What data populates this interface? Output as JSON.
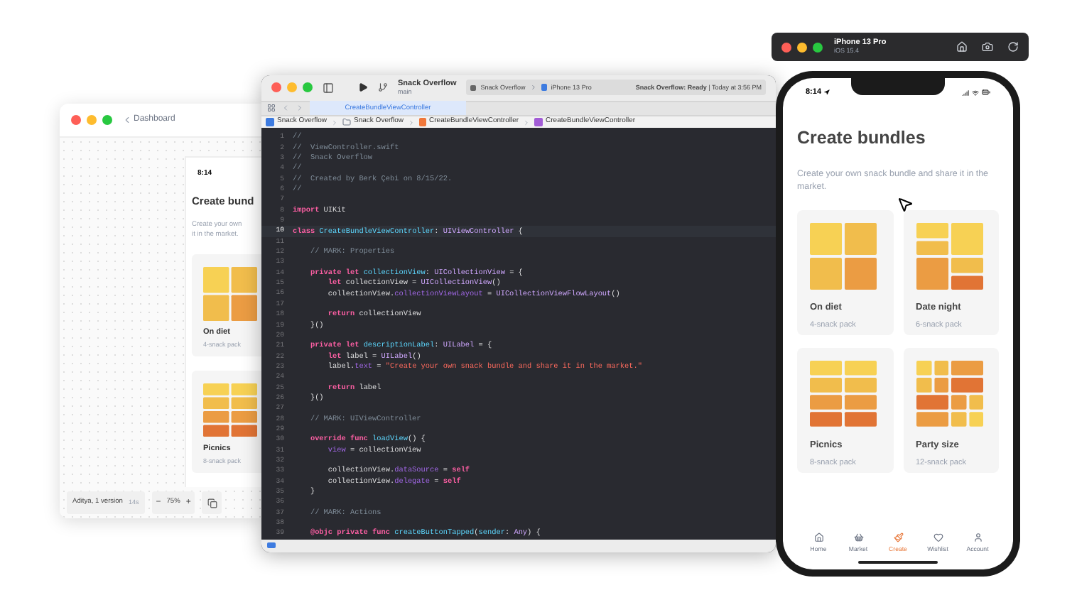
{
  "figma_window": {
    "back_label": "Dashboard",
    "time": "8:14",
    "title": "Create bund",
    "description_lines": [
      "Create your own",
      "it in the market."
    ],
    "cards": [
      {
        "kind": "quad",
        "name": "On diet",
        "pack": "4-snack pack"
      },
      {
        "kind": "stripes",
        "name": "Picnics",
        "pack": "8-snack pack"
      }
    ],
    "author": "Aditya, 1 version",
    "elapsed": "14s",
    "zoom_minus": "−",
    "zoom": "75%",
    "zoom_plus": "+"
  },
  "xcode": {
    "project": "Snack Overflow",
    "branch": "main",
    "scheme": "Snack Overflow",
    "device": "iPhone 13 Pro",
    "status_bold": "Snack Overflow: Ready",
    "status_rest": " | Today at 3:56 PM",
    "tab": "CreateBundleViewController",
    "breadcrumbs": [
      {
        "kind": "project",
        "label": "Snack Overflow"
      },
      {
        "kind": "folder",
        "label": "Snack Overflow"
      },
      {
        "kind": "swift",
        "label": "CreateBundleViewController"
      },
      {
        "kind": "class",
        "label": "CreateBundleViewController"
      }
    ],
    "lines": [
      {
        "number": "1",
        "current": false,
        "tokens": [
          {
            "kind": "c",
            "text": "//"
          }
        ]
      },
      {
        "number": "2",
        "current": false,
        "tokens": [
          {
            "kind": "c",
            "text": "//  ViewController.swift"
          }
        ]
      },
      {
        "number": "3",
        "current": false,
        "tokens": [
          {
            "kind": "c",
            "text": "//  Snack Overflow"
          }
        ]
      },
      {
        "number": "4",
        "current": false,
        "tokens": [
          {
            "kind": "c",
            "text": "//"
          }
        ]
      },
      {
        "number": "5",
        "current": false,
        "tokens": [
          {
            "kind": "c",
            "text": "//  Created by Berk Çebi on 8/15/22."
          }
        ]
      },
      {
        "number": "6",
        "current": false,
        "tokens": [
          {
            "kind": "c",
            "text": "//"
          }
        ]
      },
      {
        "number": "7",
        "current": false
      },
      {
        "number": "8",
        "current": false,
        "tokens": [
          {
            "kind": "k",
            "text": "import"
          },
          {
            "kind": "p",
            "text": " UIKit"
          }
        ]
      },
      {
        "number": "9",
        "current": false
      },
      {
        "number": "10",
        "current": true,
        "tokens": [
          {
            "kind": "k",
            "text": "class"
          },
          {
            "kind": "d",
            "text": " CreateBundleViewController"
          },
          {
            "kind": "p",
            "text": ": "
          },
          {
            "kind": "t",
            "text": "UIViewController"
          },
          {
            "kind": "p",
            "text": " {"
          }
        ]
      },
      {
        "number": "11",
        "current": false
      },
      {
        "number": "12",
        "current": false,
        "tokens": [
          {
            "kind": "c",
            "text": "    // MARK: Properties"
          }
        ]
      },
      {
        "number": "13",
        "current": false
      },
      {
        "number": "14",
        "current": false,
        "tokens": [
          {
            "kind": "k",
            "text": "    private let"
          },
          {
            "kind": "d",
            "text": " collectionView"
          },
          {
            "kind": "p",
            "text": ": "
          },
          {
            "kind": "t",
            "text": "UICollectionView"
          },
          {
            "kind": "p",
            "text": " = {"
          }
        ]
      },
      {
        "number": "15",
        "current": false,
        "tokens": [
          {
            "kind": "k",
            "text": "        let"
          },
          {
            "kind": "p",
            "text": " collectionView = "
          },
          {
            "kind": "t",
            "text": "UICollectionView"
          },
          {
            "kind": "p",
            "text": "()"
          }
        ]
      },
      {
        "number": "16",
        "current": false,
        "tokens": [
          {
            "kind": "p",
            "text": "        collectionView."
          },
          {
            "kind": "m",
            "text": "collectionViewLayout"
          },
          {
            "kind": "p",
            "text": " = "
          },
          {
            "kind": "t",
            "text": "UICollectionViewFlowLayout"
          },
          {
            "kind": "p",
            "text": "()"
          }
        ]
      },
      {
        "number": "17",
        "current": false
      },
      {
        "number": "18",
        "current": false,
        "tokens": [
          {
            "kind": "k",
            "text": "        return"
          },
          {
            "kind": "p",
            "text": " collectionView"
          }
        ]
      },
      {
        "number": "19",
        "current": false,
        "tokens": [
          {
            "kind": "p",
            "text": "    }()"
          }
        ]
      },
      {
        "number": "20",
        "current": false
      },
      {
        "number": "21",
        "current": false,
        "tokens": [
          {
            "kind": "k",
            "text": "    private let"
          },
          {
            "kind": "d",
            "text": " descriptionLabel"
          },
          {
            "kind": "p",
            "text": ": "
          },
          {
            "kind": "t",
            "text": "UILabel"
          },
          {
            "kind": "p",
            "text": " = {"
          }
        ]
      },
      {
        "number": "22",
        "current": false,
        "tokens": [
          {
            "kind": "k",
            "text": "        let"
          },
          {
            "kind": "p",
            "text": " label = "
          },
          {
            "kind": "t",
            "text": "UILabel"
          },
          {
            "kind": "p",
            "text": "()"
          }
        ]
      },
      {
        "number": "23",
        "current": false,
        "tokens": [
          {
            "kind": "p",
            "text": "        label."
          },
          {
            "kind": "m",
            "text": "text"
          },
          {
            "kind": "p",
            "text": " = "
          },
          {
            "kind": "s",
            "text": "\"Create your own snack bundle and share it in the market.\""
          }
        ]
      },
      {
        "number": "24",
        "current": false
      },
      {
        "number": "25",
        "current": false,
        "tokens": [
          {
            "kind": "k",
            "text": "        return"
          },
          {
            "kind": "p",
            "text": " label"
          }
        ]
      },
      {
        "number": "26",
        "current": false,
        "tokens": [
          {
            "kind": "p",
            "text": "    }()"
          }
        ]
      },
      {
        "number": "27",
        "current": false
      },
      {
        "number": "28",
        "current": false,
        "tokens": [
          {
            "kind": "c",
            "text": "    // MARK: UIViewController"
          }
        ]
      },
      {
        "number": "29",
        "current": false
      },
      {
        "number": "30",
        "current": false,
        "tokens": [
          {
            "kind": "k",
            "text": "    override func"
          },
          {
            "kind": "d",
            "text": " loadView"
          },
          {
            "kind": "p",
            "text": "() {"
          }
        ]
      },
      {
        "number": "31",
        "current": false,
        "tokens": [
          {
            "kind": "m",
            "text": "        view"
          },
          {
            "kind": "p",
            "text": " = collectionView"
          }
        ]
      },
      {
        "number": "32",
        "current": false
      },
      {
        "number": "33",
        "current": false,
        "tokens": [
          {
            "kind": "p",
            "text": "        collectionView."
          },
          {
            "kind": "m",
            "text": "dataSource"
          },
          {
            "kind": "p",
            "text": " = "
          },
          {
            "kind": "k",
            "text": "self"
          }
        ]
      },
      {
        "number": "34",
        "current": false,
        "tokens": [
          {
            "kind": "p",
            "text": "        collectionView."
          },
          {
            "kind": "m",
            "text": "delegate"
          },
          {
            "kind": "p",
            "text": " = "
          },
          {
            "kind": "k",
            "text": "self"
          }
        ]
      },
      {
        "number": "35",
        "current": false,
        "tokens": [
          {
            "kind": "p",
            "text": "    }"
          }
        ]
      },
      {
        "number": "36",
        "current": false
      },
      {
        "number": "37",
        "current": false,
        "tokens": [
          {
            "kind": "c",
            "text": "    // MARK: Actions"
          }
        ]
      },
      {
        "number": "38",
        "current": false
      },
      {
        "number": "39",
        "current": false,
        "tokens": [
          {
            "kind": "k",
            "text": "    @objc private func"
          },
          {
            "kind": "d",
            "text": " createButtonTapped"
          },
          {
            "kind": "p",
            "text": "("
          },
          {
            "kind": "d",
            "text": "sender"
          },
          {
            "kind": "p",
            "text": ": "
          },
          {
            "kind": "t",
            "text": "Any"
          },
          {
            "kind": "p",
            "text": ") {"
          }
        ]
      }
    ]
  },
  "simulator": {
    "device": "iPhone 13 Pro",
    "os": "iOS 15.4"
  },
  "phone": {
    "time": "8:14",
    "title": "Create bundles",
    "description": "Create your own snack bundle and share it in the market.",
    "cards": [
      {
        "kind": "quad",
        "name": "On diet",
        "pack": "4-snack pack"
      },
      {
        "kind": "date",
        "name": "Date night",
        "pack": "6-snack pack"
      },
      {
        "kind": "stripes",
        "name": "Picnics",
        "pack": "8-snack pack"
      },
      {
        "kind": "party",
        "name": "Party size",
        "pack": "12-snack pack"
      }
    ],
    "tabs": [
      {
        "kind": "home",
        "label": "Home",
        "selected": false
      },
      {
        "kind": "market",
        "label": "Market",
        "selected": false
      },
      {
        "kind": "create",
        "label": "Create",
        "selected": true
      },
      {
        "kind": "wishlist",
        "label": "Wishlist",
        "selected": false
      },
      {
        "kind": "account",
        "label": "Account",
        "selected": false
      }
    ]
  }
}
